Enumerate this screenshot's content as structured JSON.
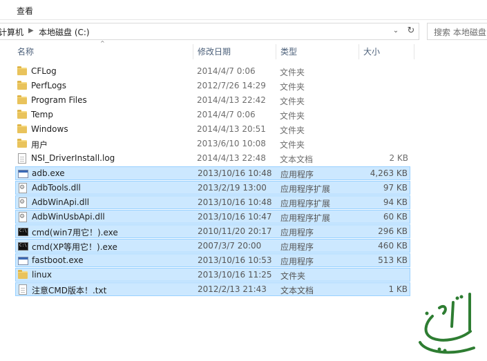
{
  "ribbon": {
    "view_tab": "查看"
  },
  "address_bar": {
    "crumbs": [
      "计算机",
      "本地磁盘 (C:)"
    ],
    "search_placeholder": "搜索 本地磁盘"
  },
  "columns": {
    "name": "名称",
    "modified": "修改日期",
    "type": "类型",
    "size": "大小"
  },
  "files": [
    {
      "name": "CFLog",
      "date": "2014/4/7 0:06",
      "type": "文件夹",
      "size": "",
      "icon": "folder-icon",
      "selected": false
    },
    {
      "name": "PerfLogs",
      "date": "2012/7/26 14:29",
      "type": "文件夹",
      "size": "",
      "icon": "folder-icon",
      "selected": false
    },
    {
      "name": "Program Files",
      "date": "2014/4/13 22:42",
      "type": "文件夹",
      "size": "",
      "icon": "folder-icon",
      "selected": false
    },
    {
      "name": "Temp",
      "date": "2014/4/7 0:06",
      "type": "文件夹",
      "size": "",
      "icon": "folder-icon",
      "selected": false
    },
    {
      "name": "Windows",
      "date": "2014/4/13 20:51",
      "type": "文件夹",
      "size": "",
      "icon": "folder-icon",
      "selected": false
    },
    {
      "name": "用户",
      "date": "2013/6/10 10:08",
      "type": "文件夹",
      "size": "",
      "icon": "folder-icon",
      "selected": false
    },
    {
      "name": "NSI_DriverInstall.log",
      "date": "2014/4/13 22:48",
      "type": "文本文档",
      "size": "2 KB",
      "icon": "text-file-icon",
      "selected": false
    },
    {
      "name": "adb.exe",
      "date": "2013/10/16 10:48",
      "type": "应用程序",
      "size": "4,263 KB",
      "icon": "exe-icon",
      "selected": true
    },
    {
      "name": "AdbTools.dll",
      "date": "2013/2/19 13:00",
      "type": "应用程序扩展",
      "size": "97 KB",
      "icon": "dll-icon",
      "selected": true
    },
    {
      "name": "AdbWinApi.dll",
      "date": "2013/10/16 10:48",
      "type": "应用程序扩展",
      "size": "94 KB",
      "icon": "dll-icon",
      "selected": true
    },
    {
      "name": "AdbWinUsbApi.dll",
      "date": "2013/10/16 10:47",
      "type": "应用程序扩展",
      "size": "60 KB",
      "icon": "dll-icon",
      "selected": true
    },
    {
      "name": "cmd(win7用它！).exe",
      "date": "2010/11/20 20:17",
      "type": "应用程序",
      "size": "296 KB",
      "icon": "cmd-icon",
      "selected": true
    },
    {
      "name": "cmd(XP等用它！).exe",
      "date": "2007/3/7 20:00",
      "type": "应用程序",
      "size": "460 KB",
      "icon": "cmd-icon",
      "selected": true
    },
    {
      "name": "fastboot.exe",
      "date": "2013/10/16 10:53",
      "type": "应用程序",
      "size": "513 KB",
      "icon": "exe-icon",
      "selected": true
    },
    {
      "name": "linux",
      "date": "2013/10/16 11:25",
      "type": "文件夹",
      "size": "",
      "icon": "folder-icon",
      "selected": true
    },
    {
      "name": "注意CMD版本！.txt",
      "date": "2012/2/13 21:43",
      "type": "文本文档",
      "size": "1 KB",
      "icon": "text-file-icon",
      "selected": true
    }
  ],
  "colors": {
    "selection_bg": "#cce8ff",
    "selection_border": "#99d1ff",
    "header_text": "#4c607a",
    "watermark_green": "#2e7d32"
  }
}
